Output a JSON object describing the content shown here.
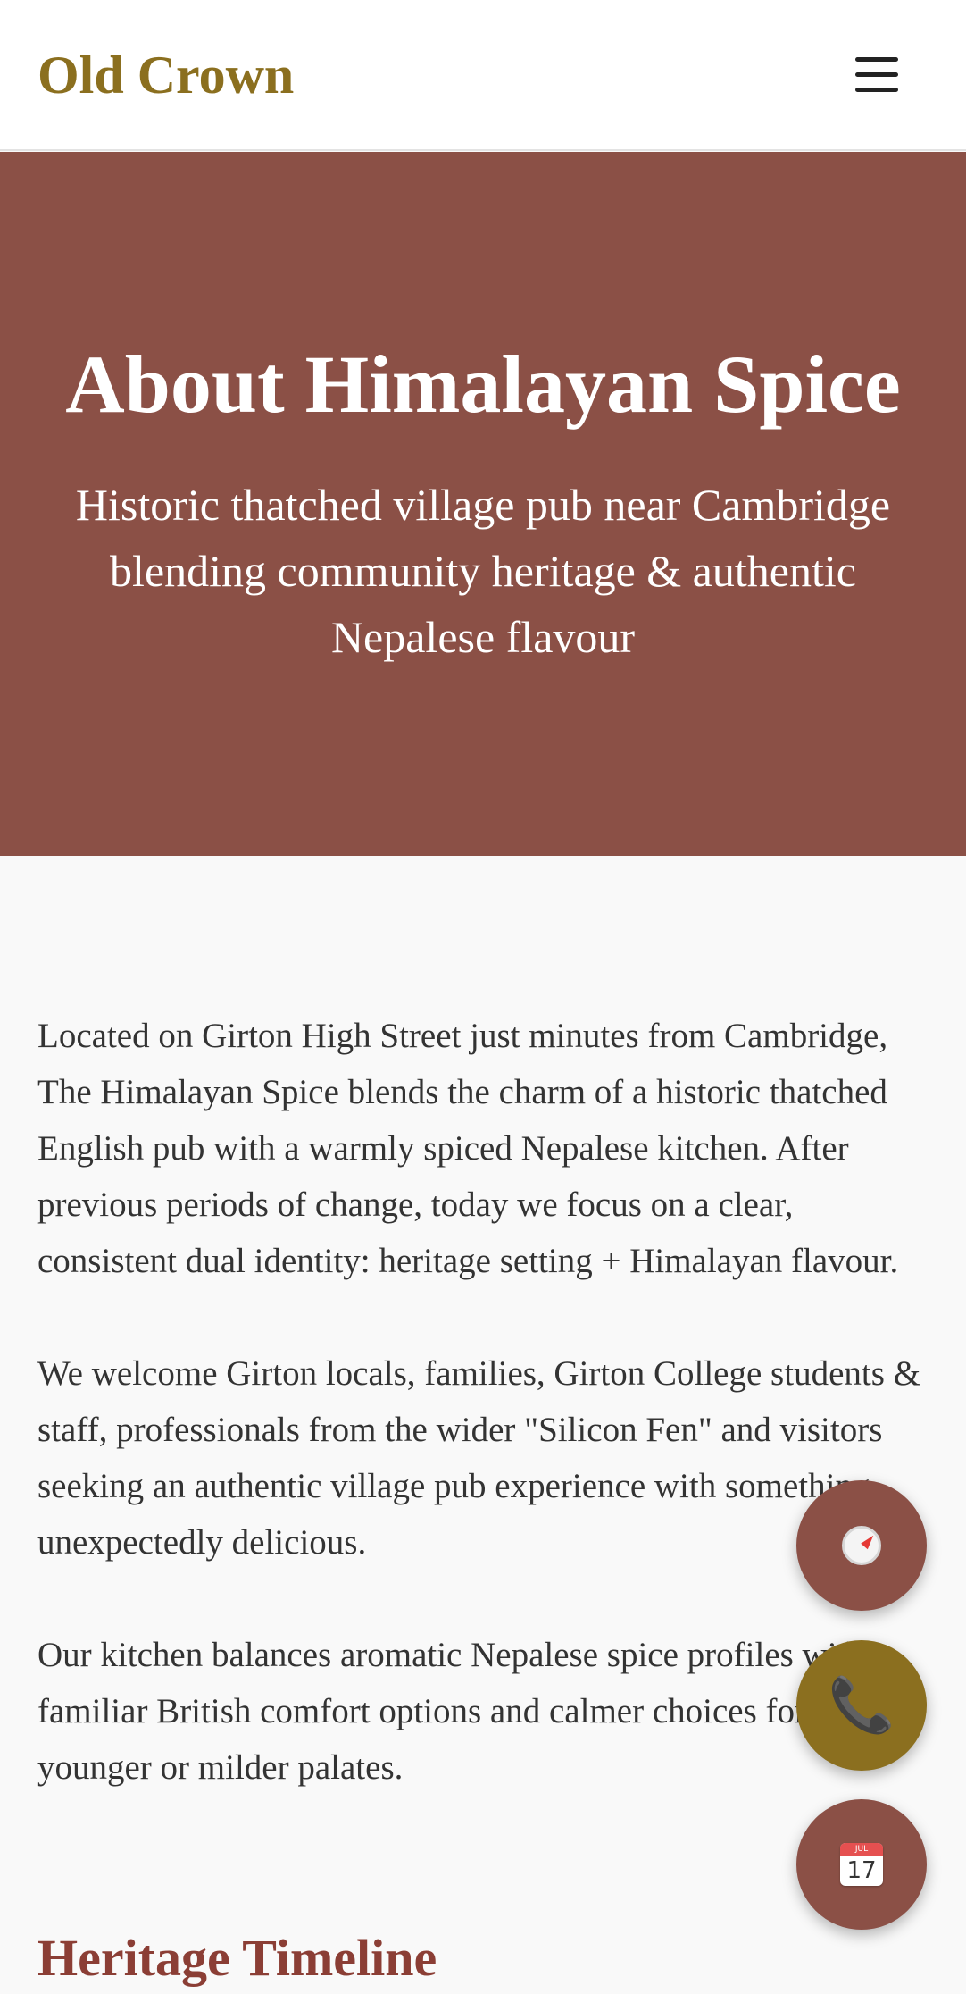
{
  "header": {
    "brand": "Old Crown",
    "menu_icon": "hamburger-menu-icon"
  },
  "hero": {
    "title": "About Himalayan Spice",
    "subtitle": "Historic thatched village pub near Cambridge blending community heritage & authentic Nepalese flavour"
  },
  "content": {
    "paragraphs": [
      "Located on Girton High Street just minutes from Cambridge, The Himalayan Spice blends the charm of a historic thatched English pub with a warmly spiced Nepalese kitchen. After previous periods of change, today we focus on a clear, consistent dual identity: heritage setting + Himalayan flavour.",
      "We welcome Girton locals, families, Girton College students & staff, professionals from the wider \"Silicon Fen\" and visitors seeking an authentic village pub experience with something unexpectedly delicious.",
      "Our kitchen balances aromatic Nepalese spice profiles with familiar British comfort options and calmer choices for younger or milder palates."
    ],
    "section_heading": "Heritage Timeline"
  },
  "fabs": {
    "directions_icon": "compass-icon",
    "call_icon": "phone-icon",
    "book_icon": "calendar-icon",
    "calendar_month": "JUL",
    "calendar_day": "17"
  },
  "colors": {
    "brand": "#8b6f1f",
    "hero_bg": "#8b5046",
    "section_heading": "#8b3e35",
    "page_bg": "#f9f9f9"
  }
}
